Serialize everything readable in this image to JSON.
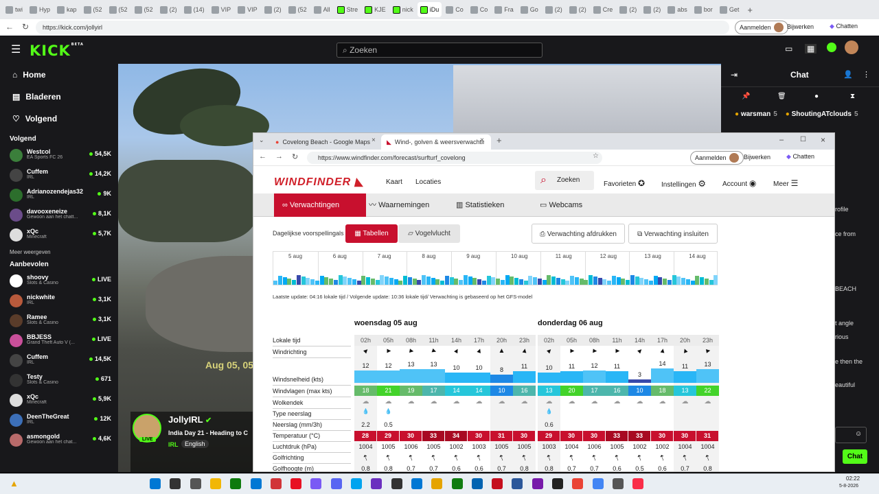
{
  "outer_browser": {
    "tabs": [
      {
        "label": "twi",
        "type": "generic"
      },
      {
        "label": "Hyp",
        "type": "generic"
      },
      {
        "label": "kap",
        "type": "generic"
      },
      {
        "label": "(52",
        "type": "generic"
      },
      {
        "label": "(52",
        "type": "generic"
      },
      {
        "label": "(52",
        "type": "generic"
      },
      {
        "label": "(2)",
        "type": "generic"
      },
      {
        "label": "(14)",
        "type": "generic"
      },
      {
        "label": "VIP",
        "type": "generic"
      },
      {
        "label": "VIP",
        "type": "generic"
      },
      {
        "label": "(2)",
        "type": "generic"
      },
      {
        "label": "(52",
        "type": "generic"
      },
      {
        "label": "All",
        "type": "generic"
      },
      {
        "label": "Stre",
        "type": "kick"
      },
      {
        "label": "KJE",
        "type": "kick"
      },
      {
        "label": "nick",
        "type": "kick"
      },
      {
        "label": "iDu",
        "type": "kick",
        "active": true
      },
      {
        "label": "Co",
        "type": "generic"
      },
      {
        "label": "Co",
        "type": "generic"
      },
      {
        "label": "Fra",
        "type": "generic"
      },
      {
        "label": "Go",
        "type": "generic"
      },
      {
        "label": "(2)",
        "type": "generic"
      },
      {
        "label": "(2)",
        "type": "generic"
      },
      {
        "label": "Cre",
        "type": "generic"
      },
      {
        "label": "(2)",
        "type": "generic"
      },
      {
        "label": "(2)",
        "type": "generic"
      },
      {
        "label": "abs",
        "type": "generic"
      },
      {
        "label": "bor",
        "type": "generic"
      },
      {
        "label": "Get",
        "type": "generic"
      }
    ],
    "url": "https://kick.com/jollyirl",
    "signin_label": "Aanmelden",
    "update_label": "Bijwerken",
    "chat_label": "Chatten"
  },
  "kick": {
    "logo": "KICK",
    "logo_badge": "BETA",
    "search_placeholder": "Zoeken",
    "nav": [
      {
        "label": "Home",
        "icon": "home-icon"
      },
      {
        "label": "Bladeren",
        "icon": "browse-icon"
      },
      {
        "label": "Volgend",
        "icon": "heart-icon"
      }
    ],
    "following_header": "Volgend",
    "following": [
      {
        "name": "Westcol",
        "category": "EA Sports FC 26",
        "viewers": "54,5K",
        "color": "#3b7f3b"
      },
      {
        "name": "Cuffem",
        "category": "IRL",
        "viewers": "14,2K",
        "color": "#444"
      },
      {
        "name": "Adrianozendejas32",
        "category": "IRL",
        "viewers": "9K",
        "color": "#2c6e2c"
      },
      {
        "name": "davooxeneize",
        "category": "Gewoon aan het chatt...",
        "viewers": "8,1K",
        "color": "#6b4c8a"
      },
      {
        "name": "xQc",
        "category": "Minecraft",
        "viewers": "5,7K",
        "color": "#ddd"
      }
    ],
    "more_label": "Meer weergeven",
    "recommended_header": "Aanbevolen",
    "recommended": [
      {
        "name": "shoovy",
        "category": "Slots & Casino",
        "viewers": "LIVE",
        "color": "#fff"
      },
      {
        "name": "nickwhite",
        "category": "IRL",
        "viewers": "3,1K",
        "color": "#b85a3c"
      },
      {
        "name": "Ramee",
        "category": "Slots & Casino",
        "viewers": "3,1K",
        "color": "#5a3c2a"
      },
      {
        "name": "BBJESS",
        "category": "Grand Theft Auto V (...",
        "viewers": "LIVE",
        "color": "#c94f9a"
      },
      {
        "name": "Cuffem",
        "category": "IRL",
        "viewers": "14,5K",
        "color": "#444"
      },
      {
        "name": "Testy",
        "category": "Slots & Casino",
        "viewers": "671",
        "color": "#333"
      },
      {
        "name": "xQc",
        "category": "Minecraft",
        "viewers": "5,9K",
        "color": "#ddd"
      },
      {
        "name": "DeenTheGreat",
        "category": "IRL",
        "viewers": "12K",
        "color": "#3c6fb8"
      },
      {
        "name": "asmongold",
        "category": "Gewoon aan het chat...",
        "viewers": "4,6K",
        "color": "#b86a6a"
      }
    ],
    "stream": {
      "overlay_date": "Aug 05, 05",
      "streamer": "JollyIRL",
      "title": "India Day 21 - Heading to C",
      "category": "IRL",
      "language": "English",
      "live_badge": "LIVE"
    },
    "chat": {
      "title": "Chat",
      "users": [
        {
          "name": "warsman",
          "count": "5"
        },
        {
          "name": "ShoutingATclouds",
          "count": "5"
        }
      ],
      "fragments": [
        "rofile",
        "ce from",
        "BEACH",
        "t angle",
        "rious",
        "e then the",
        "eautiful"
      ],
      "chat_button": "Chat"
    }
  },
  "inner_browser": {
    "tabs": [
      {
        "label": "Covelong Beach - Google Maps",
        "active": false
      },
      {
        "label": "Wind-, golven & weersverwachting",
        "active": true
      }
    ],
    "url": "https://www.windfinder.com/forecast/surfturf_covelong",
    "signin_label": "Aanmelden",
    "update_label": "Bijwerken",
    "chat_label": "Chatten"
  },
  "windfinder": {
    "logo": "WINDFINDER",
    "nav": [
      "Kaart",
      "Locaties"
    ],
    "search_label": "Zoeken",
    "favorites_label": "Favorieten",
    "settings_label": "Instellingen",
    "account_label": "Account",
    "more_label": "Meer",
    "tabs": [
      {
        "label": "Verwachtingen",
        "active": true
      },
      {
        "label": "Waarnemingen",
        "active": false
      },
      {
        "label": "Statistieken",
        "active": false
      },
      {
        "label": "Webcams",
        "active": false
      }
    ],
    "daily_label": "Dagelijkse voorspellingals",
    "view_tables": "Tabellen",
    "view_birdseye": "Vogelvlucht",
    "print_label": "Verwachting afdrukken",
    "embed_label": "Verwachting insluiten",
    "overview_days": [
      "5 aug",
      "6 aug",
      "7 aug",
      "8 aug",
      "9 aug",
      "10 aug",
      "11 aug",
      "12 aug",
      "13 aug",
      "14 aug"
    ],
    "update_text": "Laatste update: 04:16 lokale tijd / Volgende update: 10:36 lokale tijd/ Verwachting is gebaseerd op het GFS-model",
    "row_labels": {
      "time": "Lokale tijd",
      "dir": "Windrichting",
      "speed": "Windsnelheid (kts)",
      "gust": "Windvlagen (max kts)",
      "cloud": "Wolkendek",
      "precip_type": "Type neerslag",
      "precip": "Neerslag (mm/3h)",
      "temp": "Temperatuur (°C)",
      "pressure": "Luchtdruk (hPa)",
      "wave_dir": "Golfrichting",
      "wave_height": "Golfhoogte (m)"
    },
    "days": [
      {
        "title": "woensdag 05 aug",
        "hours": [
          "02h",
          "05h",
          "08h",
          "11h",
          "14h",
          "17h",
          "20h",
          "23h"
        ],
        "dir_rot": [
          45,
          90,
          100,
          110,
          30,
          20,
          0,
          10
        ],
        "speed": [
          "12",
          "12",
          "13",
          "13",
          "10",
          "10",
          "8",
          "11"
        ],
        "gust": [
          "18",
          "21",
          "19",
          "17",
          "14",
          "14",
          "10",
          "16"
        ],
        "precip": [
          "2.2",
          "0.5",
          "",
          "",
          "",
          "",
          "",
          ""
        ],
        "rain": [
          true,
          true,
          false,
          false,
          false,
          false,
          false,
          false
        ],
        "temp": [
          "28",
          "29",
          "30",
          "33",
          "34",
          "30",
          "31",
          "30"
        ],
        "pressure": [
          "1004",
          "1005",
          "1006",
          "1005",
          "1002",
          "1003",
          "1005",
          "1005"
        ],
        "wave_height": [
          "0.8",
          "0.8",
          "0.7",
          "0.7",
          "0.6",
          "0.6",
          "0.7",
          "0.8"
        ]
      },
      {
        "title": "donderdag 06 aug",
        "hours": [
          "02h",
          "05h",
          "08h",
          "11h",
          "14h",
          "17h",
          "20h",
          "23h"
        ],
        "dir_rot": [
          45,
          90,
          95,
          90,
          45,
          10,
          -20,
          80
        ],
        "speed": [
          "10",
          "11",
          "12",
          "11",
          "3",
          "14",
          "11",
          "13"
        ],
        "gust": [
          "13",
          "20",
          "17",
          "16",
          "10",
          "18",
          "13",
          "22"
        ],
        "precip": [
          "0.6",
          "",
          "",
          "",
          "",
          "",
          "",
          ""
        ],
        "rain": [
          true,
          false,
          false,
          false,
          false,
          false,
          false,
          false
        ],
        "temp": [
          "29",
          "30",
          "30",
          "33",
          "33",
          "30",
          "30",
          "31"
        ],
        "pressure": [
          "1003",
          "1004",
          "1006",
          "1005",
          "1002",
          "1002",
          "1004",
          "1004"
        ],
        "wave_height": [
          "0.8",
          "0.7",
          "0.7",
          "0.6",
          "0.5",
          "0.6",
          "0.7",
          "0.8"
        ]
      }
    ]
  },
  "taskbar": {
    "time": "02:22",
    "date": "5-8-2026"
  },
  "colors": {
    "kick_green": "#53fc18",
    "windfinder_red": "#c8102e"
  }
}
